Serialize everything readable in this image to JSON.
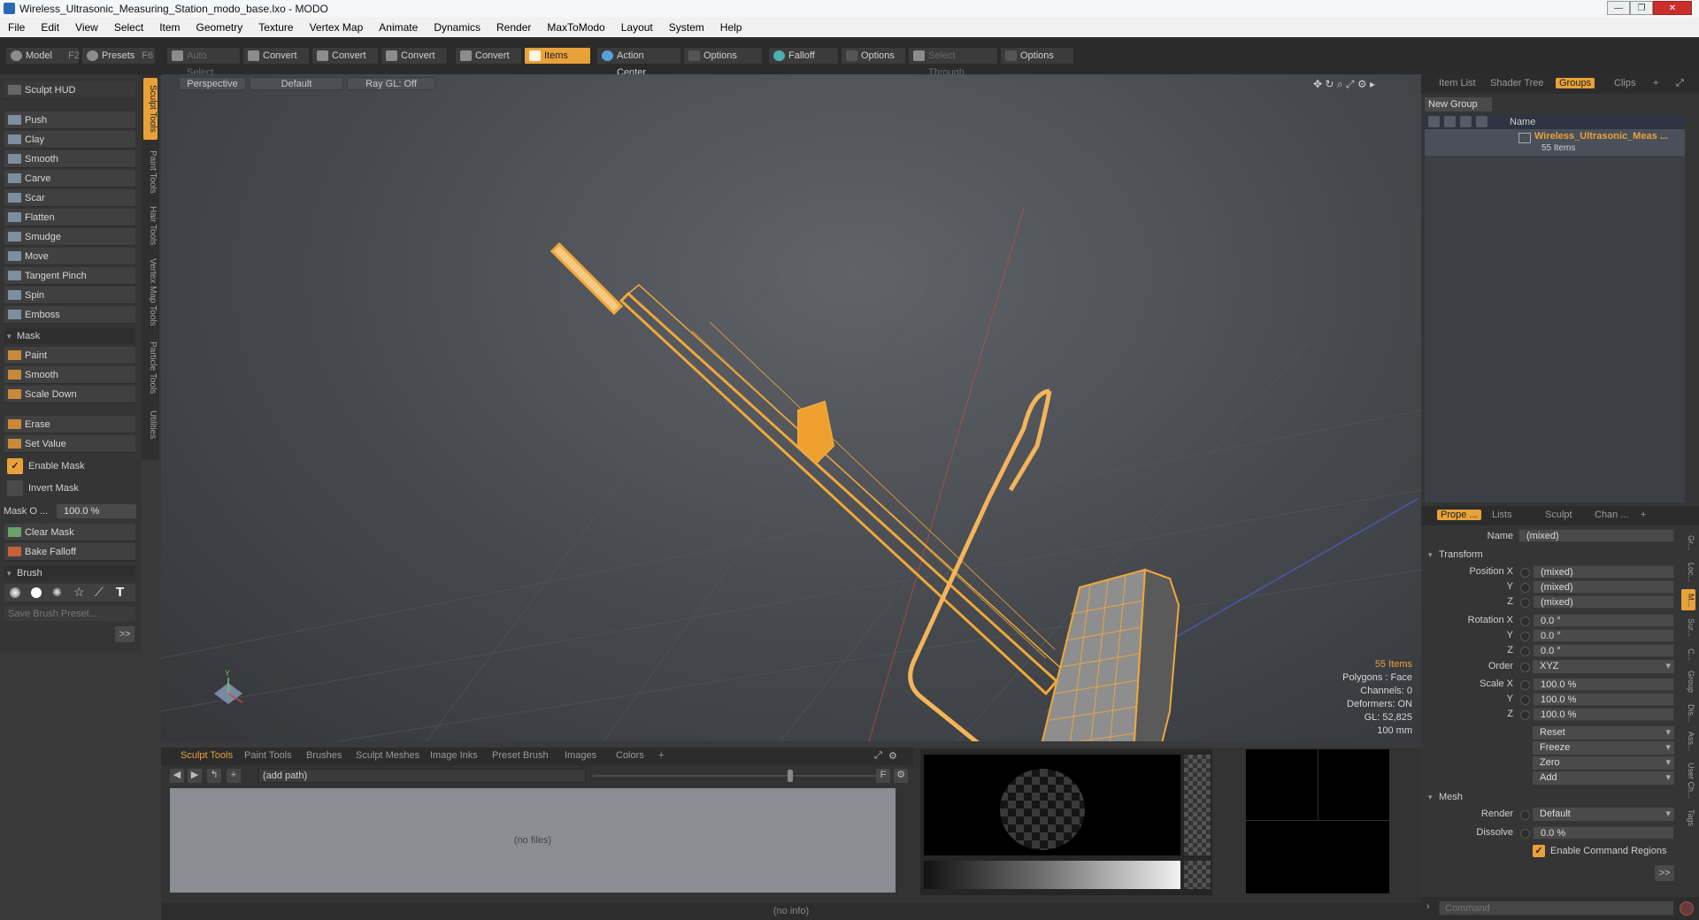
{
  "window": {
    "title": "Wireless_Ultrasonic_Measuring_Station_modo_base.lxo - MODO",
    "min": "—",
    "max": "❐",
    "close": "✕"
  },
  "menu": [
    "File",
    "Edit",
    "View",
    "Select",
    "Item",
    "Geometry",
    "Texture",
    "Vertex Map",
    "Animate",
    "Dynamics",
    "Render",
    "MaxToModo",
    "Layout",
    "System",
    "Help"
  ],
  "toolbar": {
    "model": "Model",
    "model_key": "F2",
    "presets": "Presets",
    "presets_key": "F6",
    "auto_select": "Auto Select",
    "convert": "Convert",
    "items": "Items",
    "action_center": "Action Center",
    "options": "Options",
    "falloff": "Falloff",
    "select_through": "Select Through"
  },
  "left": {
    "sculpt_hud": "Sculpt HUD",
    "tools": [
      "Push",
      "Clay",
      "Smooth",
      "Carve",
      "Scar",
      "Flatten",
      "Smudge",
      "Move",
      "Tangent Pinch",
      "Spin",
      "Emboss"
    ],
    "mask_header": "Mask",
    "mask_tools": [
      "Paint",
      "Smooth",
      "Scale Down"
    ],
    "erase": "Erase",
    "set_value": "Set Value",
    "enable_mask": "Enable Mask",
    "invert_mask": "Invert Mask",
    "mask_opacity_label": "Mask O ...",
    "mask_opacity_value": "100.0 %",
    "clear_mask": "Clear Mask",
    "bake_falloff": "Bake Falloff",
    "brush_header": "Brush",
    "save_brush_preset": "Save Brush Preset...",
    "more": ">>"
  },
  "vtabs": [
    "Sculpt Tools",
    "Paint Tools",
    "Hair Tools",
    "Vertex Map Tools",
    "Particle Tools",
    "Utilities"
  ],
  "viewport": {
    "view": "Perspective",
    "style": "Default",
    "raygl": "Ray GL: Off",
    "info": {
      "items": "55 Items",
      "polygons": "Polygons : Face",
      "channels": "Channels: 0",
      "deformers": "Deformers: ON",
      "gl": "GL: 52,825",
      "scale": "100 mm"
    },
    "axis_y": "Y"
  },
  "bottom": {
    "tabs": [
      "Sculpt Tools",
      "Paint Tools",
      "Brushes",
      "Sculpt Meshes",
      "Image Inks",
      "Preset Brush",
      "Images",
      "Colors",
      "+"
    ],
    "path": "(add path)",
    "no_files": "(no files)",
    "f_btn": "F"
  },
  "status": "(no info)",
  "right": {
    "tabs": [
      "Item List",
      "Shader Tree",
      "Groups",
      "Clips",
      "+"
    ],
    "new_group": "New Group",
    "name_col": "Name",
    "group_name": "Wireless_Ultrasonic_Meas ...",
    "group_count": "55 Items",
    "prop_tabs": [
      "Prope ...",
      "Lists",
      "Sculpt",
      "Chan ...",
      "+"
    ],
    "name_label": "Name",
    "name_value": "(mixed)",
    "transform": "Transform",
    "position_label": "Position X",
    "rotation_label": "Rotation X",
    "scale_label": "Scale X",
    "y": "Y",
    "z": "Z",
    "pos": [
      "(mixed)",
      "(mixed)",
      "(mixed)"
    ],
    "rot": [
      "0.0 °",
      "0.0 °",
      "0.0 °"
    ],
    "order_label": "Order",
    "order_value": "XYZ",
    "scl": [
      "100.0 %",
      "100.0 %",
      "100.0 %"
    ],
    "actions": [
      "Reset",
      "Freeze",
      "Zero",
      "Add"
    ],
    "mesh": "Mesh",
    "render_label": "Render",
    "render_value": "Default",
    "dissolve_label": "Dissolve",
    "dissolve_value": "0.0 %",
    "enable_cmd_regions": "Enable Command Regions",
    "more": ">>",
    "vtabs": [
      "Gr...",
      "Loc...",
      "M...",
      "Sur...",
      "C...",
      "Group",
      "Dis...",
      "Ass...",
      "User Ch...",
      "Tags"
    ],
    "command_placeholder": "Command"
  },
  "colors": {
    "accent": "#e8a23a",
    "wire": "#f0a83a",
    "bg": "#3a3a3a"
  }
}
